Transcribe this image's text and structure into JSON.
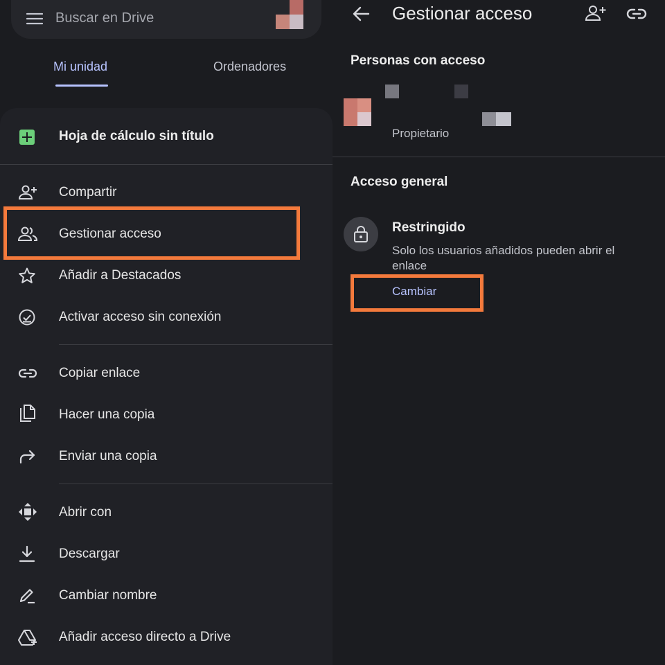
{
  "left": {
    "search": {
      "placeholder": "Buscar en Drive",
      "menu_icon": "hamburger-menu-icon"
    },
    "tabs": [
      {
        "label": "Mi unidad",
        "active": true
      },
      {
        "label": "Ordenadores",
        "active": false
      }
    ],
    "sheet": {
      "file_title": "Hoja de cálculo sin título",
      "file_icon": "google-sheets-icon",
      "groups": [
        [
          {
            "label": "Compartir",
            "icon": "add-person-icon"
          },
          {
            "label": "Gestionar acceso",
            "icon": "people-icon",
            "highlighted": true
          },
          {
            "label": "Añadir a Destacados",
            "icon": "star-icon"
          },
          {
            "label": "Activar acceso sin conexión",
            "icon": "offline-check-icon"
          }
        ],
        [
          {
            "label": "Copiar enlace",
            "icon": "link-icon"
          },
          {
            "label": "Hacer una copia",
            "icon": "copy-icon"
          },
          {
            "label": "Enviar una copia",
            "icon": "send-arrow-icon"
          }
        ],
        [
          {
            "label": "Abrir con",
            "icon": "move-arrows-icon"
          },
          {
            "label": "Descargar",
            "icon": "download-icon"
          },
          {
            "label": "Cambiar nombre",
            "icon": "pencil-icon"
          },
          {
            "label": "Añadir acceso directo a Drive",
            "icon": "drive-shortcut-icon"
          }
        ]
      ]
    }
  },
  "right": {
    "header": {
      "title": "Gestionar acceso",
      "back_icon": "arrow-back-icon",
      "add_icon": "add-person-icon",
      "link_icon": "link-icon"
    },
    "people_heading": "Personas con acceso",
    "owner": {
      "role": "Propietario"
    },
    "general_heading": "Acceso general",
    "general_access": {
      "title": "Restringido",
      "description": "Solo los usuarios añadidos pueden abrir el enlace",
      "change_label": "Cambiar",
      "icon": "lock-icon"
    }
  },
  "colors": {
    "accent": "#b7c3ff",
    "highlight": "#f47a3c",
    "sheets_green": "#6ccf7a"
  }
}
